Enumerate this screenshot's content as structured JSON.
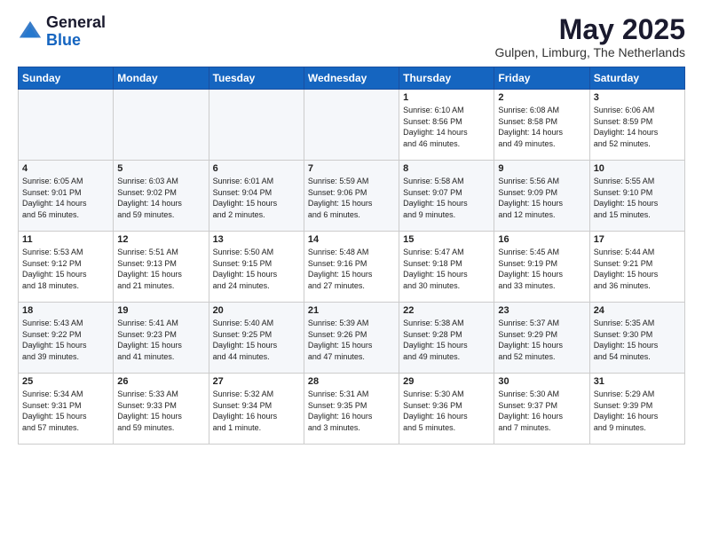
{
  "header": {
    "logo_general": "General",
    "logo_blue": "Blue",
    "month_title": "May 2025",
    "location": "Gulpen, Limburg, The Netherlands"
  },
  "days_of_week": [
    "Sunday",
    "Monday",
    "Tuesday",
    "Wednesday",
    "Thursday",
    "Friday",
    "Saturday"
  ],
  "weeks": [
    [
      {
        "day": "",
        "info": ""
      },
      {
        "day": "",
        "info": ""
      },
      {
        "day": "",
        "info": ""
      },
      {
        "day": "",
        "info": ""
      },
      {
        "day": "1",
        "info": "Sunrise: 6:10 AM\nSunset: 8:56 PM\nDaylight: 14 hours\nand 46 minutes."
      },
      {
        "day": "2",
        "info": "Sunrise: 6:08 AM\nSunset: 8:58 PM\nDaylight: 14 hours\nand 49 minutes."
      },
      {
        "day": "3",
        "info": "Sunrise: 6:06 AM\nSunset: 8:59 PM\nDaylight: 14 hours\nand 52 minutes."
      }
    ],
    [
      {
        "day": "4",
        "info": "Sunrise: 6:05 AM\nSunset: 9:01 PM\nDaylight: 14 hours\nand 56 minutes."
      },
      {
        "day": "5",
        "info": "Sunrise: 6:03 AM\nSunset: 9:02 PM\nDaylight: 14 hours\nand 59 minutes."
      },
      {
        "day": "6",
        "info": "Sunrise: 6:01 AM\nSunset: 9:04 PM\nDaylight: 15 hours\nand 2 minutes."
      },
      {
        "day": "7",
        "info": "Sunrise: 5:59 AM\nSunset: 9:06 PM\nDaylight: 15 hours\nand 6 minutes."
      },
      {
        "day": "8",
        "info": "Sunrise: 5:58 AM\nSunset: 9:07 PM\nDaylight: 15 hours\nand 9 minutes."
      },
      {
        "day": "9",
        "info": "Sunrise: 5:56 AM\nSunset: 9:09 PM\nDaylight: 15 hours\nand 12 minutes."
      },
      {
        "day": "10",
        "info": "Sunrise: 5:55 AM\nSunset: 9:10 PM\nDaylight: 15 hours\nand 15 minutes."
      }
    ],
    [
      {
        "day": "11",
        "info": "Sunrise: 5:53 AM\nSunset: 9:12 PM\nDaylight: 15 hours\nand 18 minutes."
      },
      {
        "day": "12",
        "info": "Sunrise: 5:51 AM\nSunset: 9:13 PM\nDaylight: 15 hours\nand 21 minutes."
      },
      {
        "day": "13",
        "info": "Sunrise: 5:50 AM\nSunset: 9:15 PM\nDaylight: 15 hours\nand 24 minutes."
      },
      {
        "day": "14",
        "info": "Sunrise: 5:48 AM\nSunset: 9:16 PM\nDaylight: 15 hours\nand 27 minutes."
      },
      {
        "day": "15",
        "info": "Sunrise: 5:47 AM\nSunset: 9:18 PM\nDaylight: 15 hours\nand 30 minutes."
      },
      {
        "day": "16",
        "info": "Sunrise: 5:45 AM\nSunset: 9:19 PM\nDaylight: 15 hours\nand 33 minutes."
      },
      {
        "day": "17",
        "info": "Sunrise: 5:44 AM\nSunset: 9:21 PM\nDaylight: 15 hours\nand 36 minutes."
      }
    ],
    [
      {
        "day": "18",
        "info": "Sunrise: 5:43 AM\nSunset: 9:22 PM\nDaylight: 15 hours\nand 39 minutes."
      },
      {
        "day": "19",
        "info": "Sunrise: 5:41 AM\nSunset: 9:23 PM\nDaylight: 15 hours\nand 41 minutes."
      },
      {
        "day": "20",
        "info": "Sunrise: 5:40 AM\nSunset: 9:25 PM\nDaylight: 15 hours\nand 44 minutes."
      },
      {
        "day": "21",
        "info": "Sunrise: 5:39 AM\nSunset: 9:26 PM\nDaylight: 15 hours\nand 47 minutes."
      },
      {
        "day": "22",
        "info": "Sunrise: 5:38 AM\nSunset: 9:28 PM\nDaylight: 15 hours\nand 49 minutes."
      },
      {
        "day": "23",
        "info": "Sunrise: 5:37 AM\nSunset: 9:29 PM\nDaylight: 15 hours\nand 52 minutes."
      },
      {
        "day": "24",
        "info": "Sunrise: 5:35 AM\nSunset: 9:30 PM\nDaylight: 15 hours\nand 54 minutes."
      }
    ],
    [
      {
        "day": "25",
        "info": "Sunrise: 5:34 AM\nSunset: 9:31 PM\nDaylight: 15 hours\nand 57 minutes."
      },
      {
        "day": "26",
        "info": "Sunrise: 5:33 AM\nSunset: 9:33 PM\nDaylight: 15 hours\nand 59 minutes."
      },
      {
        "day": "27",
        "info": "Sunrise: 5:32 AM\nSunset: 9:34 PM\nDaylight: 16 hours\nand 1 minute."
      },
      {
        "day": "28",
        "info": "Sunrise: 5:31 AM\nSunset: 9:35 PM\nDaylight: 16 hours\nand 3 minutes."
      },
      {
        "day": "29",
        "info": "Sunrise: 5:30 AM\nSunset: 9:36 PM\nDaylight: 16 hours\nand 5 minutes."
      },
      {
        "day": "30",
        "info": "Sunrise: 5:30 AM\nSunset: 9:37 PM\nDaylight: 16 hours\nand 7 minutes."
      },
      {
        "day": "31",
        "info": "Sunrise: 5:29 AM\nSunset: 9:39 PM\nDaylight: 16 hours\nand 9 minutes."
      }
    ]
  ]
}
